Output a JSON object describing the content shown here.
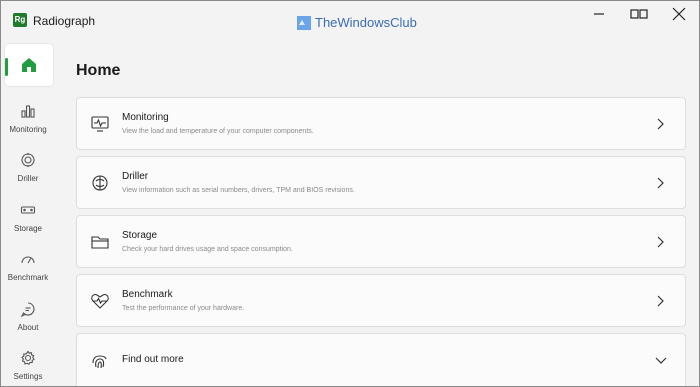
{
  "window": {
    "app_title": "Radiograph",
    "logo_text": "Rg"
  },
  "watermark": {
    "text": "TheWindowsClub"
  },
  "sidebar": {
    "items": [
      {
        "label": "",
        "icon": "home-icon"
      },
      {
        "label": "Monitoring",
        "icon": "bar-chart-icon"
      },
      {
        "label": "Driller",
        "icon": "driller-icon"
      },
      {
        "label": "Storage",
        "icon": "storage-icon"
      },
      {
        "label": "Benchmark",
        "icon": "speedometer-icon"
      },
      {
        "label": "About",
        "icon": "chat-icon"
      },
      {
        "label": "Settings",
        "icon": "gear-icon"
      }
    ]
  },
  "main": {
    "title": "Home",
    "cards": [
      {
        "title": "Monitoring",
        "description": "View the load and temperature of your computer components.",
        "icon": "monitor-pulse-icon"
      },
      {
        "title": "Driller",
        "description": "View information such as serial numbers, drivers, TPM and BIOS revisions.",
        "icon": "chip-icon"
      },
      {
        "title": "Storage",
        "description": "Check your hard drives usage and space consumption.",
        "icon": "folder-icon"
      },
      {
        "title": "Benchmark",
        "description": "Test the performance of your hardware.",
        "icon": "heart-pulse-icon"
      }
    ],
    "more": {
      "title": "Find out more",
      "icon": "fingerprint-icon"
    }
  },
  "colors": {
    "accent": "#1f9d3f",
    "logo": "#1f7a2e",
    "watermark": "#3a6db5"
  }
}
